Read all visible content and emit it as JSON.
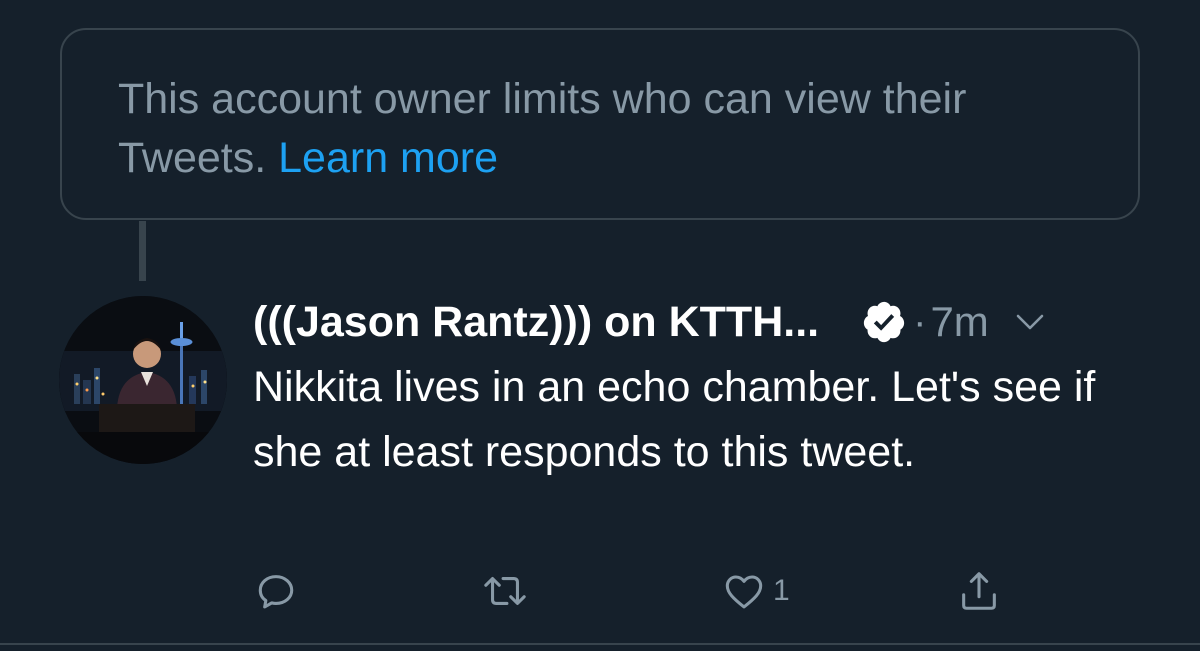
{
  "notice": {
    "text": "This account owner limits who can view their Tweets. ",
    "link_label": "Learn more"
  },
  "tweet": {
    "display_name": "(((Jason Rantz))) on KTTH...",
    "separator": "·",
    "time": "7m",
    "text": "Nikkita lives in an echo chamber. Let's see if she at least responds to this tweet.",
    "like_count": "1"
  },
  "colors": {
    "background": "#15202b",
    "border": "#38444d",
    "muted_text": "#8899a6",
    "link": "#1da1f2",
    "primary_text": "#ffffff"
  },
  "icons": {
    "verified": "verified-badge-icon",
    "menu": "chevron-down-icon",
    "reply": "reply-icon",
    "retweet": "retweet-icon",
    "like": "heart-icon",
    "share": "share-icon"
  }
}
